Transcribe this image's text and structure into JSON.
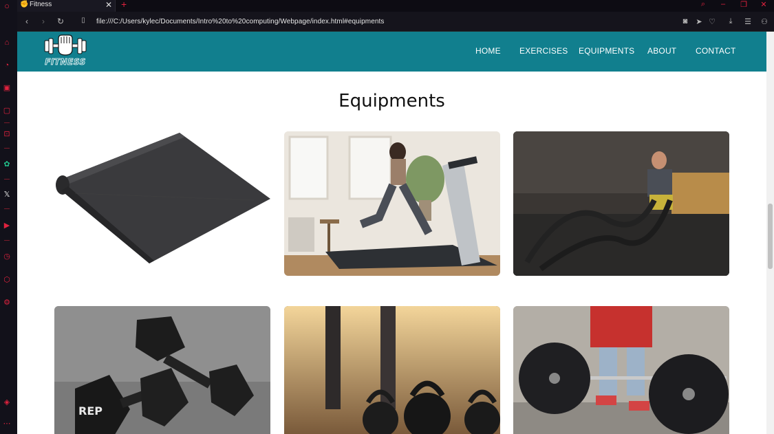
{
  "browser": {
    "tab_title": "Fitness",
    "url": "file:///C:/Users/kylec/Documents/Intro%20to%20computing/Webpage/index.html#equipments"
  },
  "site": {
    "logo_text": "FITNESS",
    "nav": [
      "HOME",
      "EXERCISES",
      "EQUIPMENTS",
      "ABOUT",
      "CONTACT"
    ],
    "section_title": "Equipments"
  },
  "equipment_images": [
    {
      "subject": "exercise-mat"
    },
    {
      "subject": "treadmill-runner"
    },
    {
      "subject": "battle-ropes"
    },
    {
      "subject": "dumbbells",
      "brand_text": "REP"
    },
    {
      "subject": "kettlebells"
    },
    {
      "subject": "barbell-deadlift"
    }
  ],
  "colors": {
    "nav_bg": "#117f8e",
    "browser_accent": "#e0223e",
    "page_bg": "#ffffff"
  }
}
